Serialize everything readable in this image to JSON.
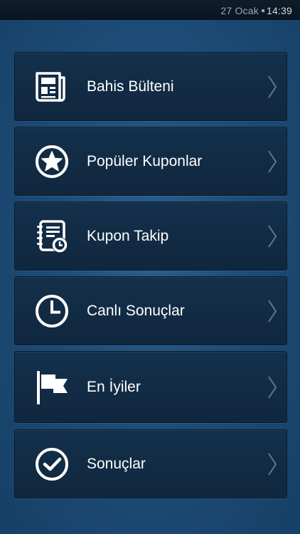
{
  "status_bar": {
    "date": "27 Ocak",
    "time": "14:39"
  },
  "menu": {
    "items": [
      {
        "label": "Bahis Bülteni",
        "icon": "newspaper-icon"
      },
      {
        "label": "Popüler Kuponlar",
        "icon": "star-circle-icon"
      },
      {
        "label": "Kupon Takip",
        "icon": "notebook-clock-icon"
      },
      {
        "label": "Canlı Sonuçlar",
        "icon": "clock-icon"
      },
      {
        "label": "En İyiler",
        "icon": "flag-icon"
      },
      {
        "label": "Sonuçlar",
        "icon": "checkmark-circle-icon"
      }
    ]
  },
  "colors": {
    "background": "#1d4d78",
    "tile": "#12293f",
    "text": "#ffffff",
    "chevron": "#5f7890"
  }
}
